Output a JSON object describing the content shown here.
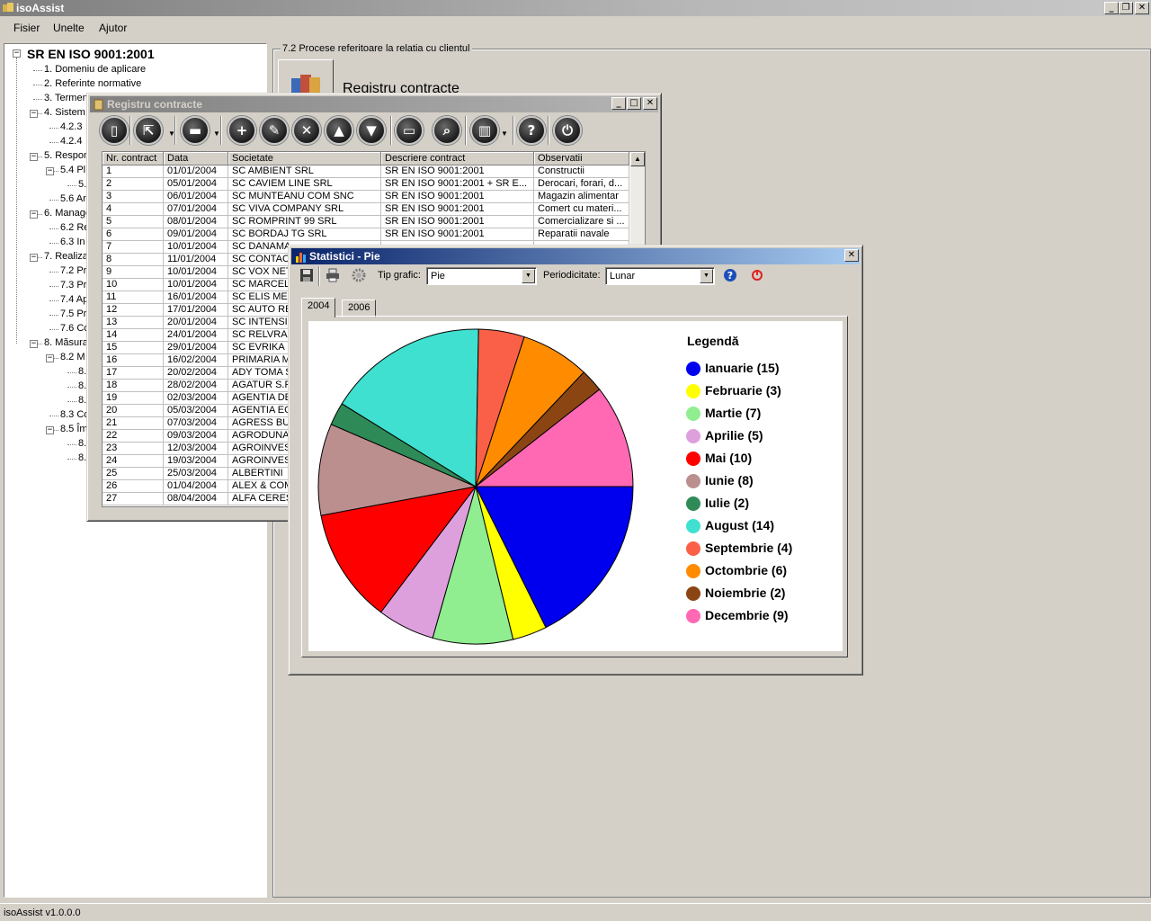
{
  "app": {
    "title": "isoAssist",
    "status": "isoAssist v1.0.0.0",
    "window_buttons": [
      "_",
      "❐",
      "✕"
    ]
  },
  "menu": [
    "Fisier",
    "Unelte",
    "Ajutor"
  ],
  "tree": {
    "root": "SR EN ISO 9001:2001",
    "items": [
      {
        "label": "1. Domeniu de aplicare"
      },
      {
        "label": "2. Referinte normative"
      },
      {
        "label": "3. Termeni si definitii"
      },
      {
        "label": "4. Sistem"
      },
      {
        "label": "4.2.3"
      },
      {
        "label": "4.2.4"
      },
      {
        "label": "5. Respon"
      },
      {
        "label": "5.4 Pl"
      },
      {
        "label": "5."
      },
      {
        "label": "5.6 Ar"
      },
      {
        "label": "6. Manage"
      },
      {
        "label": "6.2 Re"
      },
      {
        "label": "6.3 In"
      },
      {
        "label": "7. Realiza"
      },
      {
        "label": "7.2 Pr"
      },
      {
        "label": "7.3 Pr"
      },
      {
        "label": "7.4 Ap"
      },
      {
        "label": "7.5 Pr"
      },
      {
        "label": "7.6 Co"
      },
      {
        "label": "8. Măsura"
      },
      {
        "label": "8.2 M"
      },
      {
        "label": "8."
      },
      {
        "label": "8."
      },
      {
        "label": "8."
      },
      {
        "label": "8.3 Co"
      },
      {
        "label": "8.5 Îm"
      },
      {
        "label": "8."
      },
      {
        "label": "8."
      }
    ]
  },
  "group": {
    "legend": "7.2 Procese referitoare la relatia cu clientul",
    "registru_label": "Registru contracte"
  },
  "registru": {
    "title": "Registru contracte",
    "toolbar": [
      "new",
      "import",
      "save",
      "add",
      "edit",
      "delete",
      "up",
      "down",
      "print",
      "search",
      "chart",
      "help",
      "exit"
    ],
    "columns": [
      "Nr. contract",
      "Data",
      "Societate",
      "Descriere contract",
      "Observatii"
    ],
    "rows": [
      [
        "1",
        "01/01/2004",
        "SC AMBIENT SRL",
        "SR EN ISO 9001:2001",
        "Constructii"
      ],
      [
        "2",
        "05/01/2004",
        "SC CAVIEM LINE SRL",
        "SR EN ISO 9001:2001 + SR E...",
        "Derocari, forari, d..."
      ],
      [
        "3",
        "06/01/2004",
        "SC MUNTEANU COM SNC",
        "SR EN ISO 9001:2001",
        "Magazin alimentar"
      ],
      [
        "4",
        "07/01/2004",
        "SC VIVA COMPANY SRL",
        "SR EN ISO 9001:2001",
        "Comert cu materi..."
      ],
      [
        "5",
        "08/01/2004",
        "SC ROMPRINT 99 SRL",
        "SR EN ISO 9001:2001",
        "Comercializare si ..."
      ],
      [
        "6",
        "09/01/2004",
        "SC BORDAJ TG SRL",
        "SR EN ISO 9001:2001",
        "Reparatii navale"
      ],
      [
        "7",
        "10/01/2004",
        "SC DANAMA",
        "",
        ""
      ],
      [
        "8",
        "11/01/2004",
        "SC CONTAC",
        "",
        ""
      ],
      [
        "9",
        "10/01/2004",
        "SC VOX NET",
        "",
        ""
      ],
      [
        "10",
        "10/01/2004",
        "SC MARCEL",
        "",
        ""
      ],
      [
        "11",
        "16/01/2004",
        "SC ELIS MEI",
        "",
        ""
      ],
      [
        "12",
        "17/01/2004",
        "SC AUTO RE",
        "",
        ""
      ],
      [
        "13",
        "20/01/2004",
        "SC INTENSI",
        "",
        ""
      ],
      [
        "14",
        "24/01/2004",
        "SC RELVRA",
        "",
        ""
      ],
      [
        "15",
        "29/01/2004",
        "SC EVRIKA I",
        "",
        ""
      ],
      [
        "16",
        "16/02/2004",
        "PRIMARIA M",
        "",
        ""
      ],
      [
        "17",
        "20/02/2004",
        "ADY TOMA S",
        "",
        ""
      ],
      [
        "18",
        "28/02/2004",
        "AGATUR S.F",
        "",
        ""
      ],
      [
        "19",
        "02/03/2004",
        "AGENTIA DE",
        "",
        ""
      ],
      [
        "20",
        "05/03/2004",
        "AGENTIA EC",
        "",
        ""
      ],
      [
        "21",
        "07/03/2004",
        "AGRESS BU",
        "",
        ""
      ],
      [
        "22",
        "09/03/2004",
        "AGRODUNA",
        "",
        ""
      ],
      [
        "23",
        "12/03/2004",
        "AGROINVES",
        "",
        ""
      ],
      [
        "24",
        "19/03/2004",
        "AGROINVES",
        "",
        ""
      ],
      [
        "25",
        "25/03/2004",
        "ALBERTINI",
        "",
        ""
      ],
      [
        "26",
        "01/04/2004",
        "ALEX & COM",
        "",
        ""
      ],
      [
        "27",
        "08/04/2004",
        "ALFA CERES",
        "",
        ""
      ]
    ]
  },
  "statistici": {
    "title": "Statistici - Pie",
    "tip_grafic_label": "Tip grafic:",
    "tip_grafic_value": "Pie",
    "periodicitate_label": "Periodicitate:",
    "periodicitate_value": "Lunar",
    "tabs": [
      "2004",
      "2006"
    ],
    "active_tab": "2004",
    "legend_title": "Legendă"
  },
  "chart_data": {
    "type": "pie",
    "categories": [
      "Ianuarie",
      "Februarie",
      "Martie",
      "Aprilie",
      "Mai",
      "Iunie",
      "Iulie",
      "August",
      "Septembrie",
      "Octombrie",
      "Noiembrie",
      "Decembrie"
    ],
    "values": [
      15,
      3,
      7,
      5,
      10,
      8,
      2,
      14,
      4,
      6,
      2,
      9
    ],
    "legend_labels": [
      "Ianuarie (15)",
      "Februarie (3)",
      "Martie (7)",
      "Aprilie (5)",
      "Mai (10)",
      "Iunie (8)",
      "Iulie (2)",
      "August (14)",
      "Septembrie (4)",
      "Octombrie (6)",
      "Noiembrie (2)",
      "Decembrie (9)"
    ],
    "colors": [
      "#0000ee",
      "#ffff00",
      "#90ee90",
      "#dda0dd",
      "#ff0000",
      "#bc8f8f",
      "#2e8b57",
      "#40e0d0",
      "#fa6048",
      "#ff8c00",
      "#8b4513",
      "#ff69b4"
    ],
    "legend_position": "right"
  }
}
